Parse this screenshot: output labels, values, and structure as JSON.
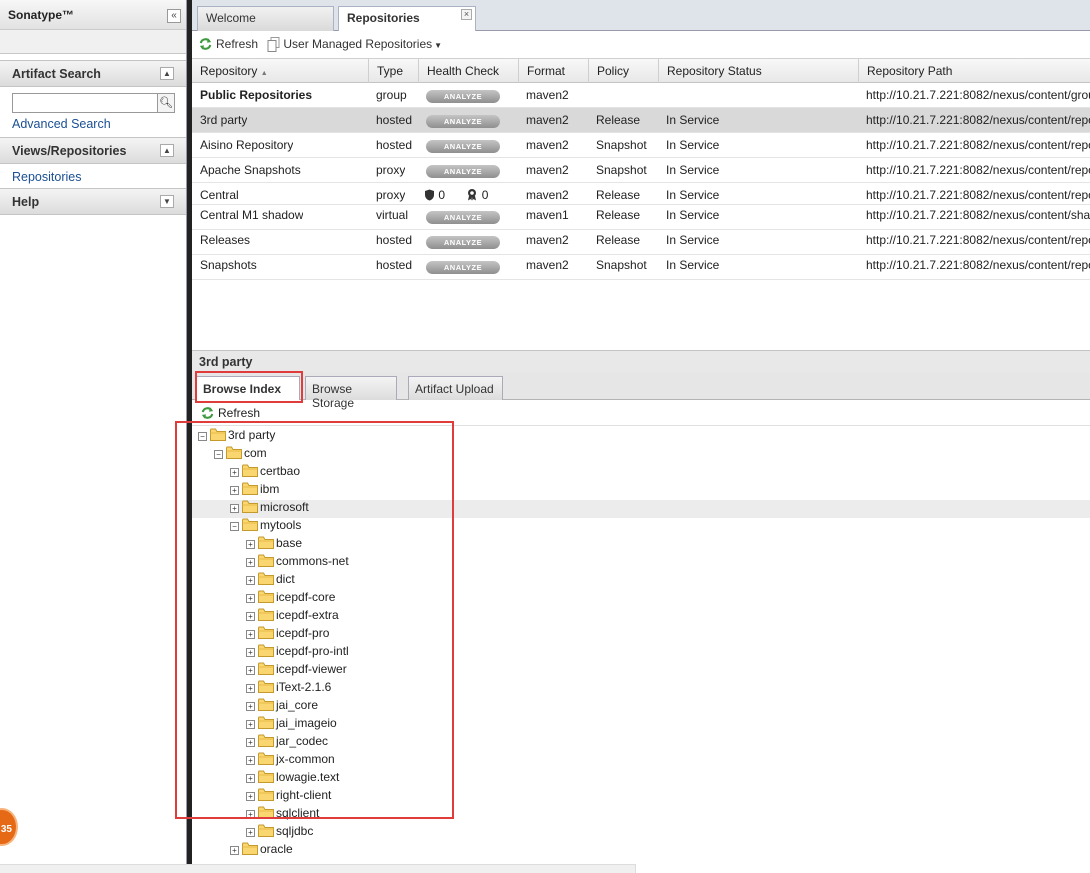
{
  "left": {
    "brand": "Sonatype™",
    "artifact_search": {
      "title": "Artifact Search",
      "search_placeholder": "",
      "advanced_link": "Advanced Search"
    },
    "views": {
      "title": "Views/Repositories",
      "items": [
        "Repositories"
      ]
    },
    "help": {
      "title": "Help"
    }
  },
  "tabs": [
    {
      "label": "Welcome"
    },
    {
      "label": "Repositories"
    }
  ],
  "toolbar": {
    "refresh": "Refresh",
    "user_managed": "User Managed Repositories"
  },
  "grid": {
    "columns": [
      "Repository",
      "Type",
      "Health Check",
      "Format",
      "Policy",
      "Repository Status",
      "Repository Path"
    ],
    "rows": [
      {
        "name": "Public Repositories",
        "type": "group",
        "health": "ANALYZE",
        "format": "maven2",
        "policy": "",
        "status": "",
        "path": "http://10.21.7.221:8082/nexus/content/grou"
      },
      {
        "name": "3rd party",
        "type": "hosted",
        "health": "ANALYZE",
        "format": "maven2",
        "policy": "Release",
        "status": "In Service",
        "path": "http://10.21.7.221:8082/nexus/content/repo"
      },
      {
        "name": "Aisino Repository",
        "type": "hosted",
        "health": "ANALYZE",
        "format": "maven2",
        "policy": "Snapshot",
        "status": "In Service",
        "path": "http://10.21.7.221:8082/nexus/content/repo"
      },
      {
        "name": "Apache Snapshots",
        "type": "proxy",
        "health": "ANALYZE",
        "format": "maven2",
        "policy": "Snapshot",
        "status": "In Service",
        "path": "http://10.21.7.221:8082/nexus/content/repo"
      },
      {
        "name": "Central",
        "type": "proxy",
        "health_security": "0",
        "health_license": "0",
        "format": "maven2",
        "policy": "Release",
        "status": "In Service",
        "path": "http://10.21.7.221:8082/nexus/content/repo"
      },
      {
        "name": "Central M1 shadow",
        "type": "virtual",
        "health": "ANALYZE",
        "format": "maven1",
        "policy": "Release",
        "status": "In Service",
        "path": "http://10.21.7.221:8082/nexus/content/sha"
      },
      {
        "name": "Releases",
        "type": "hosted",
        "health": "ANALYZE",
        "format": "maven2",
        "policy": "Release",
        "status": "In Service",
        "path": "http://10.21.7.221:8082/nexus/content/repo"
      },
      {
        "name": "Snapshots",
        "type": "hosted",
        "health": "ANALYZE",
        "format": "maven2",
        "policy": "Snapshot",
        "status": "In Service",
        "path": "http://10.21.7.221:8082/nexus/content/repo"
      }
    ]
  },
  "detail": {
    "title": "3rd party",
    "subtabs": [
      "Browse Index",
      "Browse Storage",
      "Artifact Upload"
    ],
    "refresh": "Refresh",
    "tree": [
      {
        "label": "3rd party",
        "expanded": true
      },
      {
        "label": "com",
        "expanded": true
      },
      {
        "label": "certbao",
        "expanded": false
      },
      {
        "label": "ibm",
        "expanded": false
      },
      {
        "label": "microsoft",
        "expanded": false
      },
      {
        "label": "mytools",
        "expanded": true
      },
      {
        "label": "base",
        "expanded": false
      },
      {
        "label": "commons-net",
        "expanded": false
      },
      {
        "label": "dict",
        "expanded": false
      },
      {
        "label": "icepdf-core",
        "expanded": false
      },
      {
        "label": "icepdf-extra",
        "expanded": false
      },
      {
        "label": "icepdf-pro",
        "expanded": false
      },
      {
        "label": "icepdf-pro-intl",
        "expanded": false
      },
      {
        "label": "icepdf-viewer",
        "expanded": false
      },
      {
        "label": "iText-2.1.6",
        "expanded": false
      },
      {
        "label": "jai_core",
        "expanded": false
      },
      {
        "label": "jai_imageio",
        "expanded": false
      },
      {
        "label": "jar_codec",
        "expanded": false
      },
      {
        "label": "jx-common",
        "expanded": false
      },
      {
        "label": "lowagie.text",
        "expanded": false
      },
      {
        "label": "right-client",
        "expanded": false
      },
      {
        "label": "sqlclient",
        "expanded": false
      },
      {
        "label": "sqljdbc",
        "expanded": false
      },
      {
        "label": "oracle",
        "expanded": false
      }
    ]
  },
  "badge": "35",
  "colors": {
    "highlight_box": "#e03c3c",
    "link": "#1a4f94",
    "selected_row": "#d9d9d9"
  }
}
